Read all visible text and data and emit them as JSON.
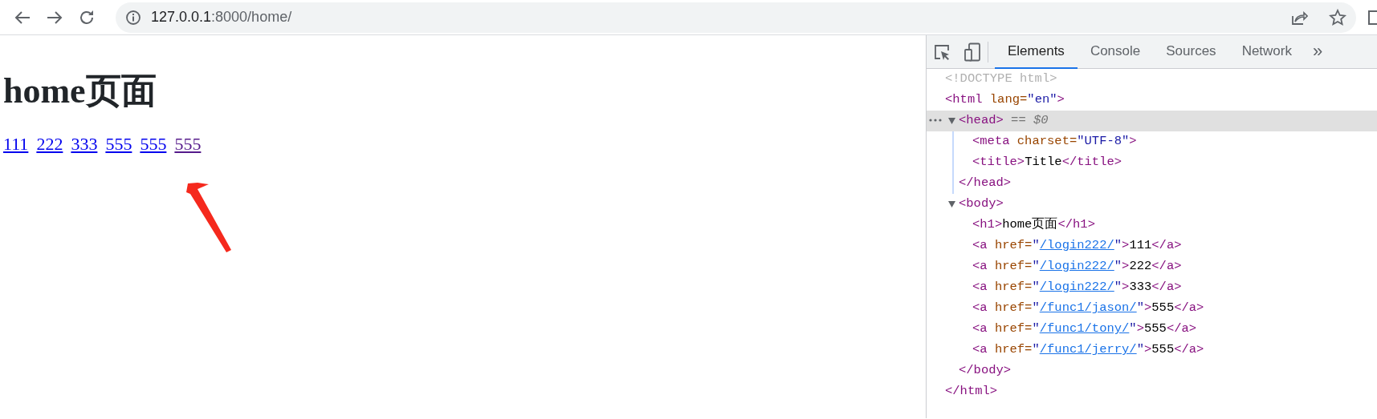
{
  "browser": {
    "address_host": "127.0.0.1",
    "address_rest": ":8000/home/"
  },
  "page": {
    "heading": "home页面",
    "links": [
      {
        "text": "111",
        "visited": false
      },
      {
        "text": "222",
        "visited": false
      },
      {
        "text": "333",
        "visited": false
      },
      {
        "text": "555",
        "visited": false
      },
      {
        "text": "555",
        "visited": false
      },
      {
        "text": "555",
        "visited": true
      }
    ]
  },
  "devtools": {
    "tabs": [
      {
        "label": "Elements",
        "selected": true
      },
      {
        "label": "Console",
        "selected": false
      },
      {
        "label": "Sources",
        "selected": false
      },
      {
        "label": "Network",
        "selected": false
      }
    ],
    "more": "»",
    "dom": [
      {
        "selected": false,
        "tokens": [
          {
            "kind": "doctype",
            "text": "<!DOCTYPE html>"
          }
        ]
      },
      {
        "selected": false,
        "tokens": [
          {
            "kind": "tag",
            "text": "<html"
          },
          {
            "kind": "attr",
            "text": " lang="
          },
          {
            "kind": "value",
            "text": "\"en\""
          },
          {
            "kind": "tag",
            "text": ">"
          }
        ],
        "children": [
          {
            "selected": true,
            "expanded": true,
            "tokens": [
              {
                "kind": "tag",
                "text": "<head>"
              },
              {
                "kind": "note",
                "text": " == $0"
              }
            ],
            "children": [
              {
                "selected": false,
                "tokens": [
                  {
                    "kind": "tag",
                    "text": "<meta"
                  },
                  {
                    "kind": "attr",
                    "text": " charset="
                  },
                  {
                    "kind": "value",
                    "text": "\"UTF-8\""
                  },
                  {
                    "kind": "tag",
                    "text": ">"
                  }
                ]
              },
              {
                "selected": false,
                "tokens": [
                  {
                    "kind": "tag",
                    "text": "<title>"
                  },
                  {
                    "kind": "text",
                    "text": "Title"
                  },
                  {
                    "kind": "tag",
                    "text": "</title>"
                  }
                ]
              }
            ],
            "end_tokens": [
              {
                "kind": "tag",
                "text": "</head>"
              }
            ]
          },
          {
            "selected": false,
            "expanded": true,
            "tokens": [
              {
                "kind": "tag",
                "text": "<body>"
              }
            ],
            "children": [
              {
                "selected": false,
                "tokens": [
                  {
                    "kind": "tag",
                    "text": "<h1>"
                  },
                  {
                    "kind": "text",
                    "text": "home页面"
                  },
                  {
                    "kind": "tag",
                    "text": "</h1>"
                  }
                ]
              },
              {
                "selected": false,
                "tokens": [
                  {
                    "kind": "tag",
                    "text": "<a"
                  },
                  {
                    "kind": "attr",
                    "text": " href="
                  },
                  {
                    "kind": "value",
                    "text": "\""
                  },
                  {
                    "kind": "link",
                    "text": "/login222/"
                  },
                  {
                    "kind": "value",
                    "text": "\""
                  },
                  {
                    "kind": "tag",
                    "text": ">"
                  },
                  {
                    "kind": "text",
                    "text": "111"
                  },
                  {
                    "kind": "tag",
                    "text": "</a>"
                  }
                ]
              },
              {
                "selected": false,
                "tokens": [
                  {
                    "kind": "tag",
                    "text": "<a"
                  },
                  {
                    "kind": "attr",
                    "text": " href="
                  },
                  {
                    "kind": "value",
                    "text": "\""
                  },
                  {
                    "kind": "link",
                    "text": "/login222/"
                  },
                  {
                    "kind": "value",
                    "text": "\""
                  },
                  {
                    "kind": "tag",
                    "text": ">"
                  },
                  {
                    "kind": "text",
                    "text": "222"
                  },
                  {
                    "kind": "tag",
                    "text": "</a>"
                  }
                ]
              },
              {
                "selected": false,
                "tokens": [
                  {
                    "kind": "tag",
                    "text": "<a"
                  },
                  {
                    "kind": "attr",
                    "text": " href="
                  },
                  {
                    "kind": "value",
                    "text": "\""
                  },
                  {
                    "kind": "link",
                    "text": "/login222/"
                  },
                  {
                    "kind": "value",
                    "text": "\""
                  },
                  {
                    "kind": "tag",
                    "text": ">"
                  },
                  {
                    "kind": "text",
                    "text": "333"
                  },
                  {
                    "kind": "tag",
                    "text": "</a>"
                  }
                ]
              },
              {
                "selected": false,
                "tokens": [
                  {
                    "kind": "tag",
                    "text": "<a"
                  },
                  {
                    "kind": "attr",
                    "text": " href="
                  },
                  {
                    "kind": "value",
                    "text": "\""
                  },
                  {
                    "kind": "link",
                    "text": "/func1/jason/"
                  },
                  {
                    "kind": "value",
                    "text": "\""
                  },
                  {
                    "kind": "tag",
                    "text": ">"
                  },
                  {
                    "kind": "text",
                    "text": "555"
                  },
                  {
                    "kind": "tag",
                    "text": "</a>"
                  }
                ]
              },
              {
                "selected": false,
                "tokens": [
                  {
                    "kind": "tag",
                    "text": "<a"
                  },
                  {
                    "kind": "attr",
                    "text": " href="
                  },
                  {
                    "kind": "value",
                    "text": "\""
                  },
                  {
                    "kind": "link",
                    "text": "/func1/tony/"
                  },
                  {
                    "kind": "value",
                    "text": "\""
                  },
                  {
                    "kind": "tag",
                    "text": ">"
                  },
                  {
                    "kind": "text",
                    "text": "555"
                  },
                  {
                    "kind": "tag",
                    "text": "</a>"
                  }
                ]
              },
              {
                "selected": false,
                "tokens": [
                  {
                    "kind": "tag",
                    "text": "<a"
                  },
                  {
                    "kind": "attr",
                    "text": " href="
                  },
                  {
                    "kind": "value",
                    "text": "\""
                  },
                  {
                    "kind": "link",
                    "text": "/func1/jerry/"
                  },
                  {
                    "kind": "value",
                    "text": "\""
                  },
                  {
                    "kind": "tag",
                    "text": ">"
                  },
                  {
                    "kind": "text",
                    "text": "555"
                  },
                  {
                    "kind": "tag",
                    "text": "</a>"
                  }
                ]
              }
            ],
            "end_tokens": [
              {
                "kind": "tag",
                "text": "</body>"
              }
            ]
          }
        ],
        "end_tokens": [
          {
            "kind": "tag",
            "text": "</html>"
          }
        ]
      }
    ]
  }
}
